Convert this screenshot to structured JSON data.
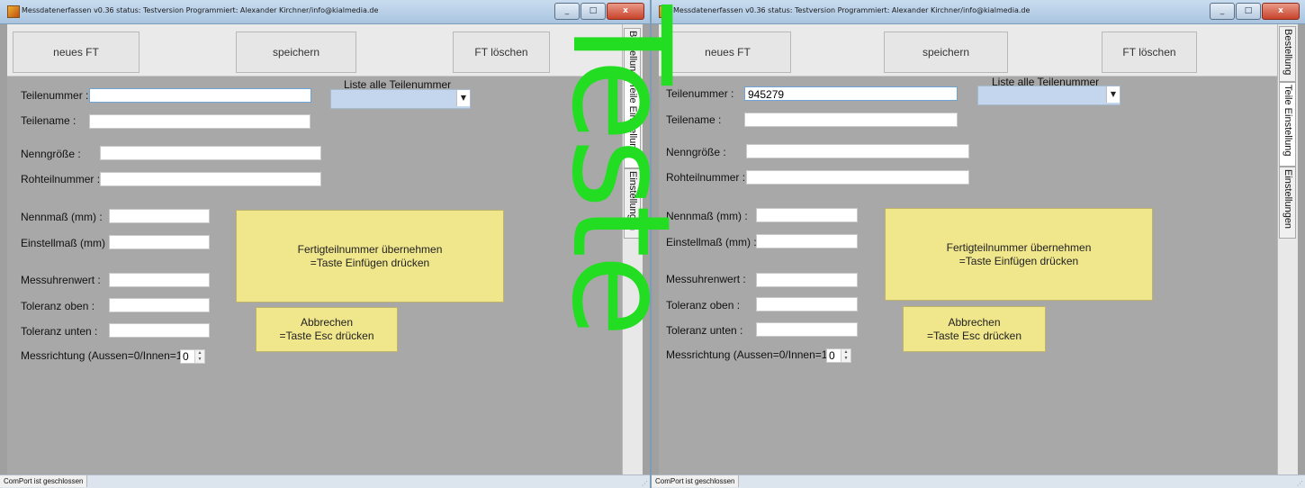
{
  "window_title": "Messdatenerfassen  v0.36  status: Testversion  Programmiert: Alexander Kirchner/info@kialmedia.de",
  "window_buttons": {
    "minimize": "_",
    "maximize": "□",
    "close": "x"
  },
  "toolbar": {
    "new_ft": "neues FT",
    "save": "speichern",
    "delete_ft": "FT löschen"
  },
  "labels": {
    "teilenummer": "Teilenummer :",
    "teilename": "Teilename :",
    "nenngroesse": "Nenngröße :",
    "rohteilnummer": "Rohteilnummer :",
    "nennmass": "Nennmaß (mm) :",
    "einstellmass": "Einstellmaß (mm) :",
    "messuhrenwert": "Messuhrenwert :",
    "toleranz_oben": "Toleranz oben :",
    "toleranz_unten": "Toleranz unten :",
    "messrichtung": "Messrichtung (Aussen=0/Innen=1)",
    "liste": "Liste alle Teilenummer"
  },
  "buttons": {
    "uebernehmen_line1": "Fertigteilnummer übernehmen",
    "uebernehmen_line2": "=Taste Einfügen drücken",
    "abbrechen_line1": "Abbrechen",
    "abbrechen_line2": "=Taste Esc drücken"
  },
  "tabs": [
    "Bestellung",
    "Teile Einstellung",
    "Einstellungen"
  ],
  "status": "ComPort ist geschlossen",
  "left_values": {
    "teilenummer": "",
    "messrichtung": "0"
  },
  "right_values": {
    "teilenummer": "945279",
    "messrichtung": "0"
  },
  "watermark_text": "Teste",
  "colors": {
    "watermark": "#22dd22",
    "yellow_button": "#f0e68c"
  }
}
